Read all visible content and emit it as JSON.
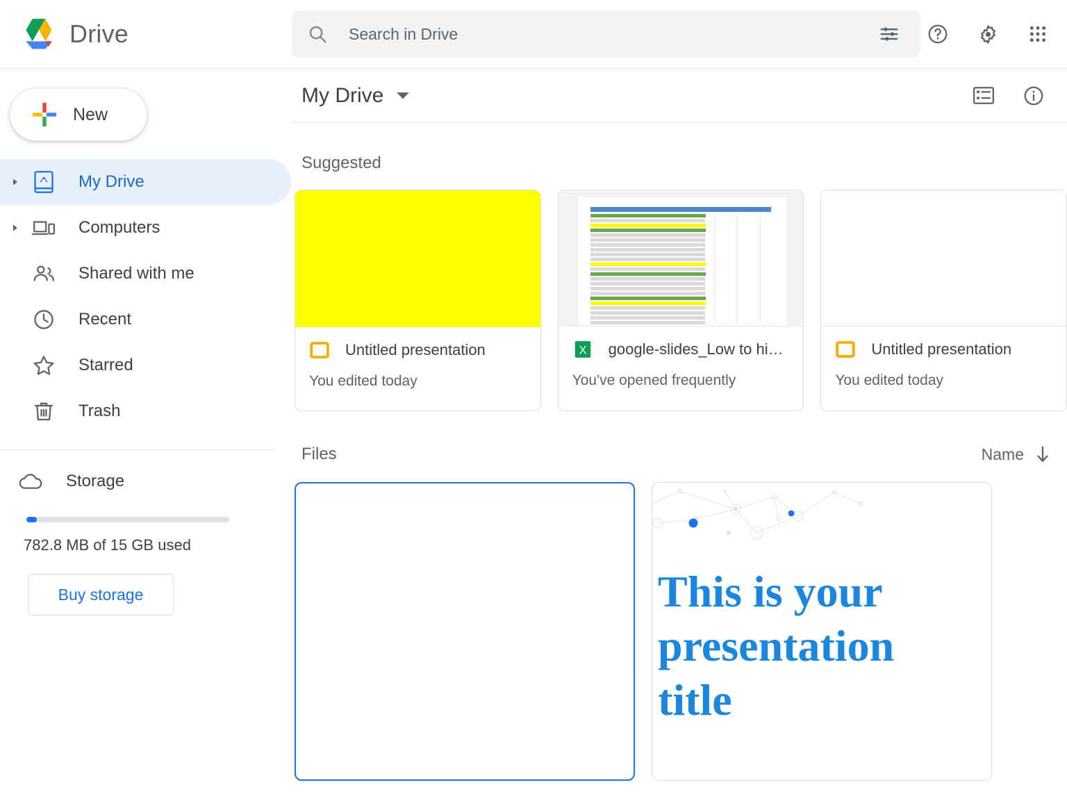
{
  "app": {
    "brand_name": "Drive",
    "logo_icon": "drive-logo-icon"
  },
  "search": {
    "placeholder": "Search in Drive",
    "value": "",
    "search_icon": "search-icon",
    "tune_icon": "tune-filter-icon"
  },
  "header_actions": [
    {
      "name": "help-icon",
      "label": "Help"
    },
    {
      "name": "settings-gear-icon",
      "label": "Settings"
    },
    {
      "name": "apps-grid-icon",
      "label": "Google apps"
    }
  ],
  "sidebar": {
    "new_button": {
      "label": "New",
      "icon": "plus-icon"
    },
    "items": [
      {
        "label": "My Drive",
        "icon": "my-drive-icon",
        "active": true,
        "expandable": true
      },
      {
        "label": "Computers",
        "icon": "computers-icon",
        "active": false,
        "expandable": true
      },
      {
        "label": "Shared with me",
        "icon": "shared-with-me-icon",
        "active": false,
        "expandable": false
      },
      {
        "label": "Recent",
        "icon": "clock-icon",
        "active": false,
        "expandable": false
      },
      {
        "label": "Starred",
        "icon": "star-icon",
        "active": false,
        "expandable": false
      },
      {
        "label": "Trash",
        "icon": "trash-icon",
        "active": false,
        "expandable": false
      }
    ],
    "storage": {
      "label": "Storage",
      "icon": "cloud-icon",
      "usage_text": "782.8 MB of 15 GB used",
      "percent_used": 5,
      "buy_button_label": "Buy storage"
    }
  },
  "main": {
    "breadcrumb": "My Drive",
    "breadcrumb_caret": "chevron-down-icon",
    "view_toggle_icon": "list-view-icon",
    "info_icon": "info-icon",
    "suggested_label": "Suggested",
    "files_label": "Files",
    "sort": {
      "label": "Name",
      "direction_icon": "arrow-down-icon"
    }
  },
  "suggested": [
    {
      "name": "Untitled presentation",
      "subtitle": "You edited today",
      "type_icon": "google-slides-icon",
      "thumb": "yellow",
      "thumb_color": "#ffff00"
    },
    {
      "name": "google-slides_Low to hi…",
      "subtitle": "You've opened frequently",
      "type_icon": "google-sheets-icon",
      "thumb": "spreadsheet"
    },
    {
      "name": "Untitled presentation",
      "subtitle": "You edited today",
      "type_icon": "google-slides-icon",
      "thumb": "blank"
    }
  ],
  "files": [
    {
      "thumb": "blank",
      "selected": true,
      "title": ""
    },
    {
      "thumb": "presentation-title",
      "selected": false,
      "title": "This is your presentation title"
    }
  ],
  "colors": {
    "accent_blue": "#1a73e8",
    "active_nav_bg": "#e8f0fe",
    "active_nav_text": "#1967d2",
    "slides_yellow": "#f9ab00",
    "sheets_green": "#0f9d58",
    "title_blue": "#1a86e0",
    "text_primary": "#3c4043",
    "text_secondary": "#5f6368"
  }
}
